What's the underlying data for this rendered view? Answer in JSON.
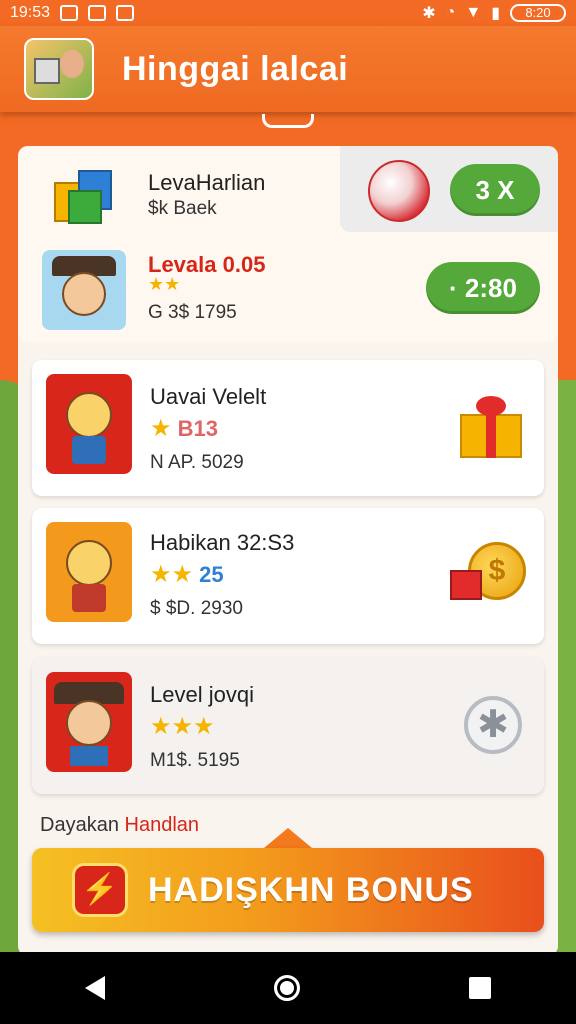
{
  "status_bar": {
    "time": "19:53",
    "battery": "8:20"
  },
  "app": {
    "title": "Hinggai lalcai"
  },
  "top_card": {
    "item1": {
      "title": "LevaHarlian",
      "subtitle": "$k Baek"
    },
    "badge_count": "3 X",
    "item2": {
      "title": "Levala 0.05",
      "subtitle": "G 3$ 1795",
      "stars": "★★"
    },
    "timer": "· 2:80"
  },
  "rows": [
    {
      "title": "Uavai Velelt",
      "stars": "★",
      "stars_text": "B13",
      "subtitle": "N AP. 5029",
      "reward_icon": "gift-icon"
    },
    {
      "title": "Habikan 32:S3",
      "stars": "★★",
      "stars_text": "25",
      "subtitle": "$ $D. 2930",
      "reward_icon": "coin-icon"
    },
    {
      "title": "Level jovqi",
      "stars": "★★★",
      "stars_text": "",
      "subtitle": "M1$. 5195",
      "reward_icon": "snowflake-icon"
    }
  ],
  "section": {
    "label_a": "Dayakan",
    "label_b": "Handlan"
  },
  "bonus": {
    "label": "HADIŞKHN BONUS",
    "icon": "⚡"
  },
  "colors": {
    "accent": "#f26a23",
    "green": "#54a93a",
    "gold": "#f5b400"
  },
  "nav": {
    "back": "back-icon",
    "home": "home-icon",
    "recent": "recent-icon"
  }
}
